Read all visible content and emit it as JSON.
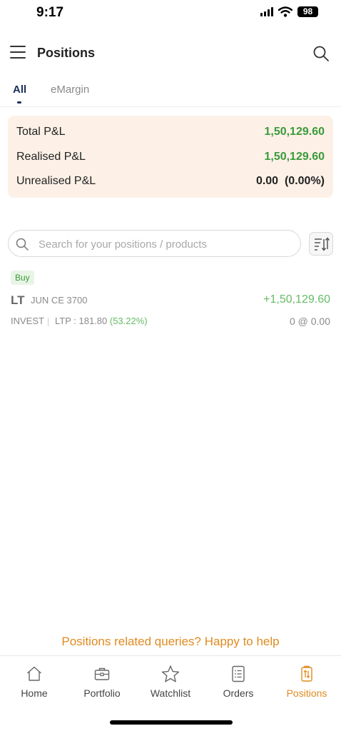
{
  "status_bar": {
    "time": "9:17",
    "battery": "98"
  },
  "header": {
    "title": "Positions"
  },
  "tabs": [
    {
      "label": "All",
      "active": true
    },
    {
      "label": "eMargin",
      "active": false
    }
  ],
  "pnl": [
    {
      "label": "Total P&L",
      "value": "1,50,129.60"
    },
    {
      "label": "Realised P&L",
      "value": "1,50,129.60"
    },
    {
      "label": "Unrealised P&L",
      "value": "0.00  (0.00%)"
    }
  ],
  "search": {
    "placeholder": "Search for your positions / products",
    "value": ""
  },
  "positions": [
    {
      "side": "Buy",
      "symbol": "LT",
      "contract": "JUN CE 3700",
      "pnl": "+1,50,129.60",
      "product": "INVEST",
      "ltp_label": "LTP : 181.80",
      "ltp_change": "(53.22%)",
      "qty_price": "0 @ 0.00"
    }
  ],
  "help_text": "Positions related queries? Happy to help",
  "bottom_nav": [
    {
      "label": "Home",
      "icon": "home-icon"
    },
    {
      "label": "Portfolio",
      "icon": "briefcase-icon"
    },
    {
      "label": "Watchlist",
      "icon": "star-icon"
    },
    {
      "label": "Orders",
      "icon": "orders-icon"
    },
    {
      "label": "Positions",
      "icon": "positions-icon",
      "active": true
    }
  ],
  "colors": {
    "accent": "#e08a1e",
    "profit": "#3a9a3a",
    "card_bg": "#fdf1e7",
    "active_tab": "#1a2f5c"
  }
}
